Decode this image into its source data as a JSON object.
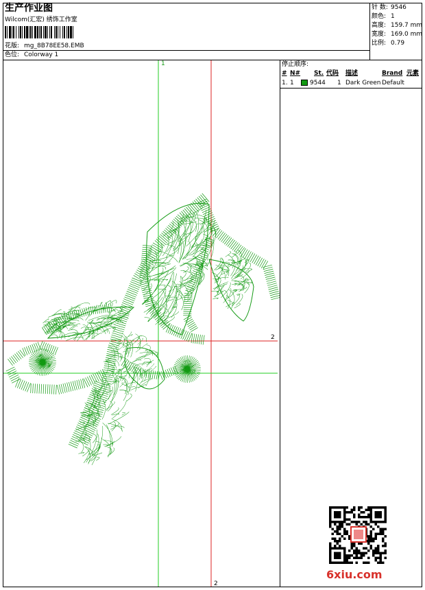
{
  "header": {
    "title": "生产作业图",
    "company": "Wilcom(汇宏) 绣饰工作室",
    "design_label": "花版:",
    "design_file": "mg_8B78EE58.EMB",
    "colorway_label": "色位:",
    "colorway": "Colorway 1"
  },
  "info": {
    "stitches_label": "针 数:",
    "stitches": "9546",
    "colors_label": "颜色:",
    "colors": "1",
    "height_label": "高度:",
    "height": "159.7 mm",
    "width_label": "宽度:",
    "width": "169.0 mm",
    "scale_label": "比例:",
    "scale": "0.79"
  },
  "stop_sequence": {
    "title": "停止顺序:",
    "headers": [
      "#",
      "N#",
      "St.",
      "代码",
      "描述",
      "Brand",
      "元素"
    ],
    "rows": [
      {
        "index": "1.",
        "needle": "1",
        "stitches": "9544",
        "code": "1",
        "description": "Dark Green",
        "brand": "Default",
        "color": "#119911"
      }
    ]
  },
  "canvas": {
    "marker_top": "1",
    "marker_right": "2",
    "marker_bottom": "2",
    "stitch_color": "#119911",
    "axis_green": "#22cc22",
    "axis_red": "#dd2222"
  },
  "footer": {
    "watermark": "6xiu.com"
  }
}
